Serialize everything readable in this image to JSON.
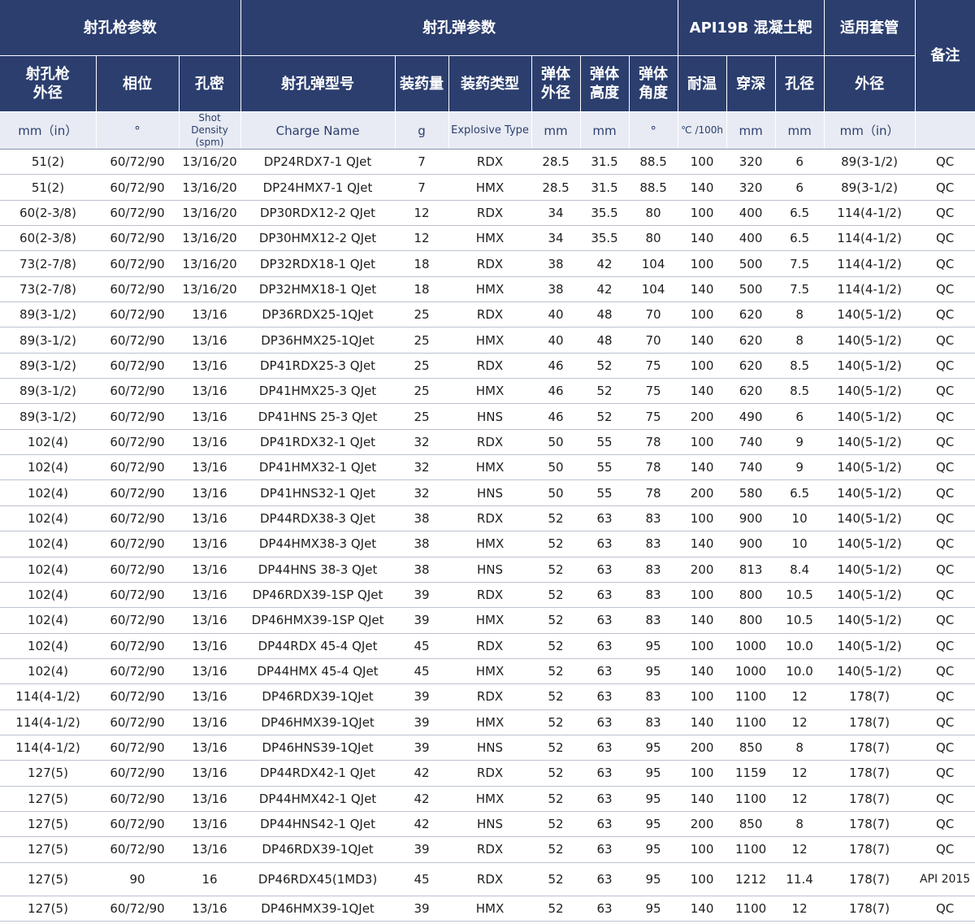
{
  "headers": {
    "group_gun": "射孔枪参数",
    "group_charge": "射孔弹参数",
    "group_api": "API19B 混凝土靶",
    "group_casing": "适用套管",
    "remark": "备注",
    "gun_od": "射孔枪 外径",
    "phase": "相位",
    "density": "孔密",
    "charge_model": "射孔弹型号",
    "charge_load": "装药量",
    "explosive_type": "装药类型",
    "body_od": "弹体 外径",
    "body_height": "弹体 高度",
    "body_angle": "弹体 角度",
    "temp_rating": "耐温",
    "penetration": "穿深",
    "hole_dia": "孔径",
    "casing_od": "外径"
  },
  "units": {
    "gun_od": "mm（in）",
    "phase": "°",
    "density": "Shot Density (spm)",
    "charge_model": "Charge Name",
    "charge_load": "g",
    "explosive_type": "Explosive Type",
    "body_od": "mm",
    "body_height": "mm",
    "body_angle": "°",
    "temp_rating": "℃ /100h",
    "penetration": "mm",
    "hole_dia": "mm",
    "casing_od": "mm（in）"
  },
  "rows": [
    [
      "51(2)",
      "60/72/90",
      "13/16/20",
      "DP24RDX7-1 QJet",
      "7",
      "RDX",
      "28.5",
      "31.5",
      "88.5",
      "100",
      "320",
      "6",
      "89(3-1/2)",
      "QC"
    ],
    [
      "51(2)",
      "60/72/90",
      "13/16/20",
      "DP24HMX7-1 QJet",
      "7",
      "HMX",
      "28.5",
      "31.5",
      "88.5",
      "140",
      "320",
      "6",
      "89(3-1/2)",
      "QC"
    ],
    [
      "60(2-3/8)",
      "60/72/90",
      "13/16/20",
      "DP30RDX12-2 QJet",
      "12",
      "RDX",
      "34",
      "35.5",
      "80",
      "100",
      "400",
      "6.5",
      "114(4-1/2)",
      "QC"
    ],
    [
      "60(2-3/8)",
      "60/72/90",
      "13/16/20",
      "DP30HMX12-2 QJet",
      "12",
      "HMX",
      "34",
      "35.5",
      "80",
      "140",
      "400",
      "6.5",
      "114(4-1/2)",
      "QC"
    ],
    [
      "73(2-7/8)",
      "60/72/90",
      "13/16/20",
      "DP32RDX18-1 QJet",
      "18",
      "RDX",
      "38",
      "42",
      "104",
      "100",
      "500",
      "7.5",
      "114(4-1/2)",
      "QC"
    ],
    [
      "73(2-7/8)",
      "60/72/90",
      "13/16/20",
      "DP32HMX18-1 QJet",
      "18",
      "HMX",
      "38",
      "42",
      "104",
      "140",
      "500",
      "7.5",
      "114(4-1/2)",
      "QC"
    ],
    [
      "89(3-1/2)",
      "60/72/90",
      "13/16",
      "DP36RDX25-1QJet",
      "25",
      "RDX",
      "40",
      "48",
      "70",
      "100",
      "620",
      "8",
      "140(5-1/2)",
      "QC"
    ],
    [
      "89(3-1/2)",
      "60/72/90",
      "13/16",
      "DP36HMX25-1QJet",
      "25",
      "HMX",
      "40",
      "48",
      "70",
      "140",
      "620",
      "8",
      "140(5-1/2)",
      "QC"
    ],
    [
      "89(3-1/2)",
      "60/72/90",
      "13/16",
      "DP41RDX25-3 QJet",
      "25",
      "RDX",
      "46",
      "52",
      "75",
      "100",
      "620",
      "8.5",
      "140(5-1/2)",
      "QC"
    ],
    [
      "89(3-1/2)",
      "60/72/90",
      "13/16",
      "DP41HMX25-3 QJet",
      "25",
      "HMX",
      "46",
      "52",
      "75",
      "140",
      "620",
      "8.5",
      "140(5-1/2)",
      "QC"
    ],
    [
      "89(3-1/2)",
      "60/72/90",
      "13/16",
      "DP41HNS 25-3 QJet",
      "25",
      "HNS",
      "46",
      "52",
      "75",
      "200",
      "490",
      "6",
      "140(5-1/2)",
      "QC"
    ],
    [
      "102(4)",
      "60/72/90",
      "13/16",
      "DP41RDX32-1 QJet",
      "32",
      "RDX",
      "50",
      "55",
      "78",
      "100",
      "740",
      "9",
      "140(5-1/2)",
      "QC"
    ],
    [
      "102(4)",
      "60/72/90",
      "13/16",
      "DP41HMX32-1 QJet",
      "32",
      "HMX",
      "50",
      "55",
      "78",
      "140",
      "740",
      "9",
      "140(5-1/2)",
      "QC"
    ],
    [
      "102(4)",
      "60/72/90",
      "13/16",
      "DP41HNS32-1 QJet",
      "32",
      "HNS",
      "50",
      "55",
      "78",
      "200",
      "580",
      "6.5",
      "140(5-1/2)",
      "QC"
    ],
    [
      "102(4)",
      "60/72/90",
      "13/16",
      "DP44RDX38-3 QJet",
      "38",
      "RDX",
      "52",
      "63",
      "83",
      "100",
      "900",
      "10",
      "140(5-1/2)",
      "QC"
    ],
    [
      "102(4)",
      "60/72/90",
      "13/16",
      "DP44HMX38-3 QJet",
      "38",
      "HMX",
      "52",
      "63",
      "83",
      "140",
      "900",
      "10",
      "140(5-1/2)",
      "QC"
    ],
    [
      "102(4)",
      "60/72/90",
      "13/16",
      "DP44HNS 38-3 QJet",
      "38",
      "HNS",
      "52",
      "63",
      "83",
      "200",
      "813",
      "8.4",
      "140(5-1/2)",
      "QC"
    ],
    [
      "102(4)",
      "60/72/90",
      "13/16",
      "DP46RDX39-1SP QJet",
      "39",
      "RDX",
      "52",
      "63",
      "83",
      "100",
      "800",
      "10.5",
      "140(5-1/2)",
      "QC"
    ],
    [
      "102(4)",
      "60/72/90",
      "13/16",
      "DP46HMX39-1SP QJet",
      "39",
      "HMX",
      "52",
      "63",
      "83",
      "140",
      "800",
      "10.5",
      "140(5-1/2)",
      "QC"
    ],
    [
      "102(4)",
      "60/72/90",
      "13/16",
      "DP44RDX 45-4 QJet",
      "45",
      "RDX",
      "52",
      "63",
      "95",
      "100",
      "1000",
      "10.0",
      "140(5-1/2)",
      "QC"
    ],
    [
      "102(4)",
      "60/72/90",
      "13/16",
      "DP44HMX 45-4 QJet",
      "45",
      "HMX",
      "52",
      "63",
      "95",
      "140",
      "1000",
      "10.0",
      "140(5-1/2)",
      "QC"
    ],
    [
      "114(4-1/2)",
      "60/72/90",
      "13/16",
      "DP46RDX39-1QJet",
      "39",
      "RDX",
      "52",
      "63",
      "83",
      "100",
      "1100",
      "12",
      "178(7)",
      "QC"
    ],
    [
      "114(4-1/2)",
      "60/72/90",
      "13/16",
      "DP46HMX39-1QJet",
      "39",
      "HMX",
      "52",
      "63",
      "83",
      "140",
      "1100",
      "12",
      "178(7)",
      "QC"
    ],
    [
      "114(4-1/2)",
      "60/72/90",
      "13/16",
      "DP46HNS39-1QJet",
      "39",
      "HNS",
      "52",
      "63",
      "95",
      "200",
      "850",
      "8",
      "178(7)",
      "QC"
    ],
    [
      "127(5)",
      "60/72/90",
      "13/16",
      "DP44RDX42-1 QJet",
      "42",
      "RDX",
      "52",
      "63",
      "95",
      "100",
      "1159",
      "12",
      "178(7)",
      "QC"
    ],
    [
      "127(5)",
      "60/72/90",
      "13/16",
      "DP44HMX42-1 QJet",
      "42",
      "HMX",
      "52",
      "63",
      "95",
      "140",
      "1100",
      "12",
      "178(7)",
      "QC"
    ],
    [
      "127(5)",
      "60/72/90",
      "13/16",
      "DP44HNS42-1 QJet",
      "42",
      "HNS",
      "52",
      "63",
      "95",
      "200",
      "850",
      "8",
      "178(7)",
      "QC"
    ],
    [
      "127(5)",
      "60/72/90",
      "13/16",
      "DP46RDX39-1QJet",
      "39",
      "RDX",
      "52",
      "63",
      "95",
      "100",
      "1100",
      "12",
      "178(7)",
      "QC"
    ],
    [
      "127(5)",
      "90",
      "16",
      "DP46RDX45(1MD3)",
      "45",
      "RDX",
      "52",
      "63",
      "95",
      "100",
      "1212",
      "11.4",
      "178(7)",
      "API 2015"
    ],
    [
      "127(5)",
      "60/72/90",
      "13/16",
      "DP46HMX39-1QJet",
      "39",
      "HMX",
      "52",
      "63",
      "95",
      "140",
      "1100",
      "12",
      "178(7)",
      "QC"
    ]
  ]
}
